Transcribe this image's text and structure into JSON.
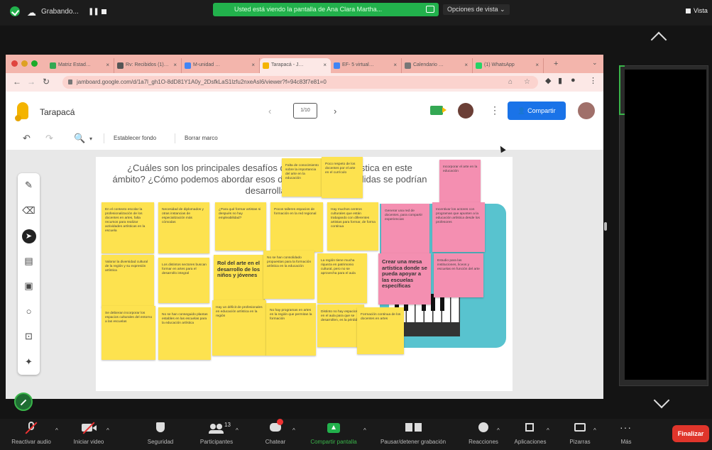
{
  "zoom_top": {
    "recording_label": "Grabando...",
    "share_banner": "Usted está viendo la pantalla de Ana Clara Martha...",
    "view_options": "Opciones de vista ⌄",
    "view_right": "Vista"
  },
  "browser": {
    "tabs": [
      {
        "label": "Matriz Estad…",
        "color": "#34a853"
      },
      {
        "label": "Rv: Recibidos (1)…",
        "color": "#555555"
      },
      {
        "label": "M-unidad …",
        "color": "#4285f4"
      },
      {
        "label": "Tarapacá - J…",
        "color": "#f4b400"
      },
      {
        "label": "EF- 5 virtual…",
        "color": "#4285f4"
      },
      {
        "label": "Calendario …",
        "color": "#555555"
      },
      {
        "label": "(1) WhatsApp",
        "color": "#25d366"
      }
    ],
    "url": "jamboard.google.com/d/1a7l_gh1O-8dD81Y1A0y_2DsfkLaS1lzfu2nxeAsI6/viewer?f=94c83f7e81=0"
  },
  "jamboard": {
    "title": "Tarapacá",
    "frame_indicator": "1/10",
    "share_label": "Compartir",
    "toolbar": {
      "set_background": "Establecer fondo",
      "clear_frame": "Borrar marco"
    }
  },
  "board": {
    "question": "¿Cuáles son los principales desafíos de la educación artística en este ámbito? ¿Cómo podemos abordar esos desafíos? ¿Qué medidas se podrían desarrollar?",
    "notes": [
      "Falta de conocimiento sobre la importancia del arte en la educación",
      "Poco respeto de los docentes por el arte en el currículo",
      "Incorporar el arte en la educación",
      "En el contexto escolar la profesionalización de los docentes en artes, falta recursos para realizar actividades artísticas en la escuela",
      "Necesidad de diplomados y otras instancias de especialización más cómodas",
      "¿Para qué formar artistas si después no hay empleabilidad?",
      "Pocos talleres espacios de formación en la red regional",
      "Hay muchos centros culturales que están trabajando con diferentes artistas para formar, de forma continua",
      "Generar una red de docentes, para compartir experiencias",
      "Incentivar los actores con programas que apunten a la educación artística desde los profesores",
      "Valorar la diversidad cultural de la región y su expresión artística",
      "Los distintos sectores buscan formar en artes para el desarrollo integral",
      "Rol del arte en el desarrollo de los niños y jóvenes",
      "No se han consolidado propuestas para la formación artística en la educación",
      "La región tiene mucha riqueza en patrimonio cultural, pero no se aprovecha para el aula",
      "Crear una mesa artística donde se pueda apoyar a las escuelas específicas",
      "Estudio para las instituciones, liceos y escuelas en función del arte",
      "Se debieran incorporar los espacios culturales del entorno a las escuelas",
      "No se han conseguido plantas estables en las escuelas para la educación artística",
      "Hay un déficit de profesionales en educación artística en la región",
      "No hay programas en artes en la región que permitan la formación",
      "Distinto no hay espacios en el aula para que se desarrollen, es la pérdida",
      "Formación continua de los docentes en artes"
    ]
  },
  "zoom_bottom": {
    "mute_label": "Reactivar audio",
    "video_label": "Iniciar video",
    "security_label": "Seguridad",
    "participants_label": "Participantes",
    "participants_count": "13",
    "chat_label": "Chatear",
    "share_label": "Compartir pantalla",
    "record_label": "Pausar/detener grabación",
    "reactions_label": "Reacciones",
    "apps_label": "Aplicaciones",
    "whiteboards_label": "Pizarras",
    "more_label": "Más",
    "end_label": "Finalizar"
  }
}
